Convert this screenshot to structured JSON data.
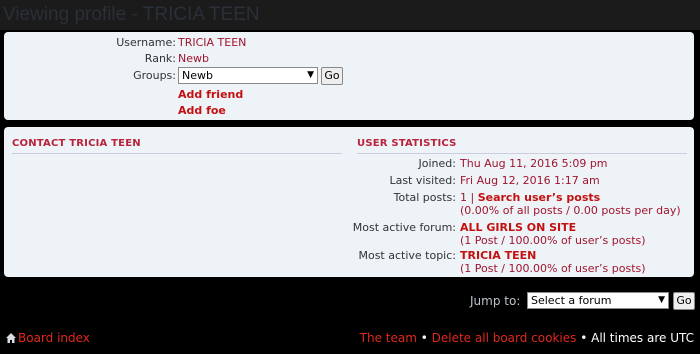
{
  "page": {
    "title": "Viewing profile - TRICIA TEEN"
  },
  "profile": {
    "username_label": "Username:",
    "username": "TRICIA TEEN",
    "rank_label": "Rank:",
    "rank": "Newb",
    "groups_label": "Groups:",
    "groups_selected": "Newb",
    "go_label": "Go",
    "add_friend": "Add friend",
    "add_foe": "Add foe"
  },
  "contact": {
    "heading": "CONTACT TRICIA TEEN"
  },
  "stats": {
    "heading": "USER STATISTICS",
    "joined_label": "Joined:",
    "joined": "Thu Aug 11, 2016 5:09 pm",
    "last_visited_label": "Last visited:",
    "last_visited": "Fri Aug 12, 2016 1:17 am",
    "total_posts_label": "Total posts:",
    "total_posts": "1",
    "total_posts_sep": " | ",
    "search_posts": "Search user’s posts",
    "total_posts_sub": "(0.00% of all posts / 0.00 posts per day)",
    "active_forum_label": "Most active forum:",
    "active_forum": "ALL GIRLS ON SITE",
    "active_forum_sub": "(1 Post / 100.00% of user’s posts)",
    "active_topic_label": "Most active topic:",
    "active_topic": "TRICIA TEEN",
    "active_topic_sub": "(1 Post / 100.00% of user’s posts)"
  },
  "jump": {
    "label": "Jump to:",
    "selected": "Select a forum",
    "go_label": "Go"
  },
  "footer": {
    "board_index": "Board index",
    "the_team": "The team",
    "separator": " • ",
    "delete_cookies": "Delete all board cookies",
    "times": "All times are UTC"
  },
  "colors": {
    "accent": "#a0152f",
    "link_bold": "#c41010",
    "panel": "#eef3f7"
  }
}
